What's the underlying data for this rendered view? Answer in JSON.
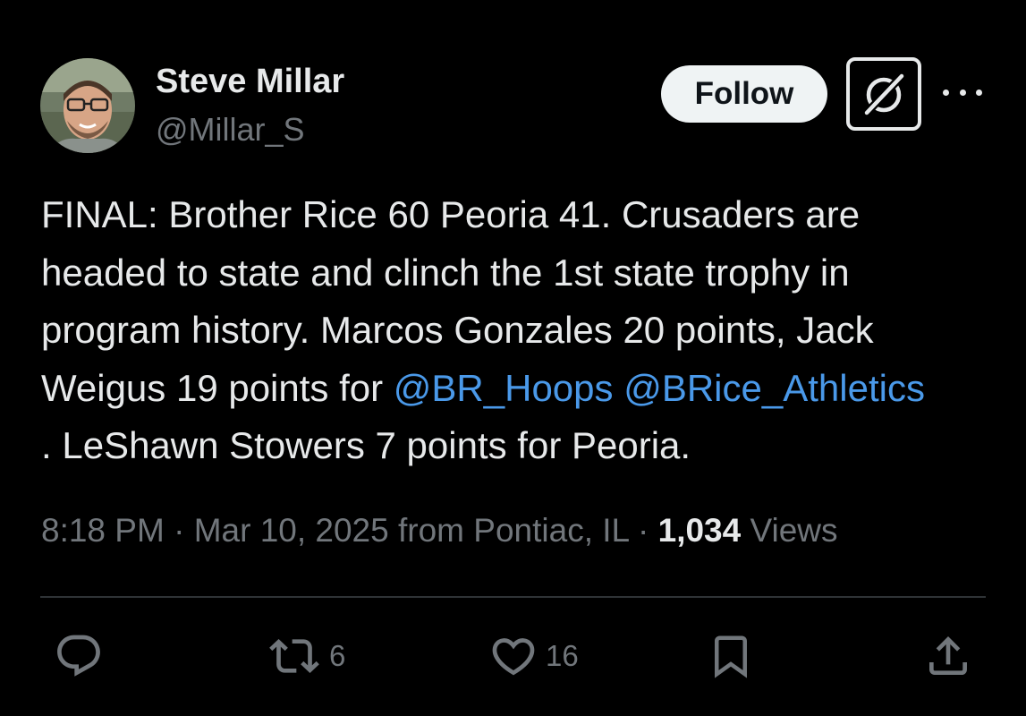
{
  "author": {
    "name": "Steve Millar",
    "handle": "@Millar_S"
  },
  "header": {
    "follow_label": "Follow",
    "grok_icon": "grok-icon",
    "more_icon": "more-icon"
  },
  "tweet": {
    "lines": [
      "FINAL: Brother Rice 60 Peoria 41. Crusaders are",
      "headed to state and clinch the 1st state trophy in",
      "program history. Marcos Gonzales 20  points, Jack",
      "Weigus 19 points for "
    ],
    "mention_1": "@BR_Hoops",
    "mention_2": "@BRice_Athletics",
    "last_line": ". LeShawn Stowers 7 points for Peoria.",
    "mention_color": "#4a99e9"
  },
  "meta": {
    "time": "8:18 PM",
    "sep": " · ",
    "date": "Mar 10, 2025",
    "location": " from Pontiac, IL",
    "views_count": "1,034",
    "views_label": " Views"
  },
  "actions": {
    "reply_icon": "reply-icon",
    "retweet_icon": "retweet-icon",
    "retweet_count": "6",
    "like_icon": "heart-icon",
    "like_count": "16",
    "bookmark_icon": "bookmark-icon",
    "share_icon": "share-icon"
  }
}
